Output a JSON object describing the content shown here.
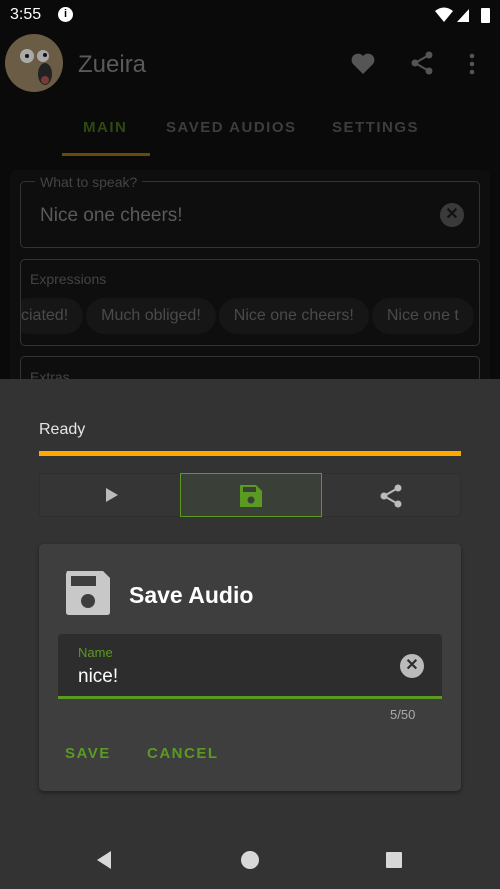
{
  "status": {
    "time": "3:55"
  },
  "appbar": {
    "title": "Zueira",
    "icons": [
      "heart-icon",
      "share-icon",
      "more-vert-icon"
    ]
  },
  "tabs": [
    {
      "label": "MAIN",
      "active": true
    },
    {
      "label": "SAVED AUDIOS"
    },
    {
      "label": "SETTINGS"
    }
  ],
  "main": {
    "speak_label": "What to speak?",
    "speak_value": "Nice one cheers!",
    "expressions_label": "Expressions",
    "chips": [
      "ciated!",
      "Much obliged!",
      "Nice one cheers!",
      "Nice one t"
    ],
    "extras_label": "Extras"
  },
  "sheet": {
    "status": "Ready",
    "progress_percent": 100,
    "progress_color": "#ffa800"
  },
  "dialog": {
    "title": "Save Audio",
    "name_label": "Name",
    "name_value": "nice!",
    "counter": "5/50",
    "save": "SAVE",
    "cancel": "CANCEL",
    "accent": "#5a9a22"
  }
}
